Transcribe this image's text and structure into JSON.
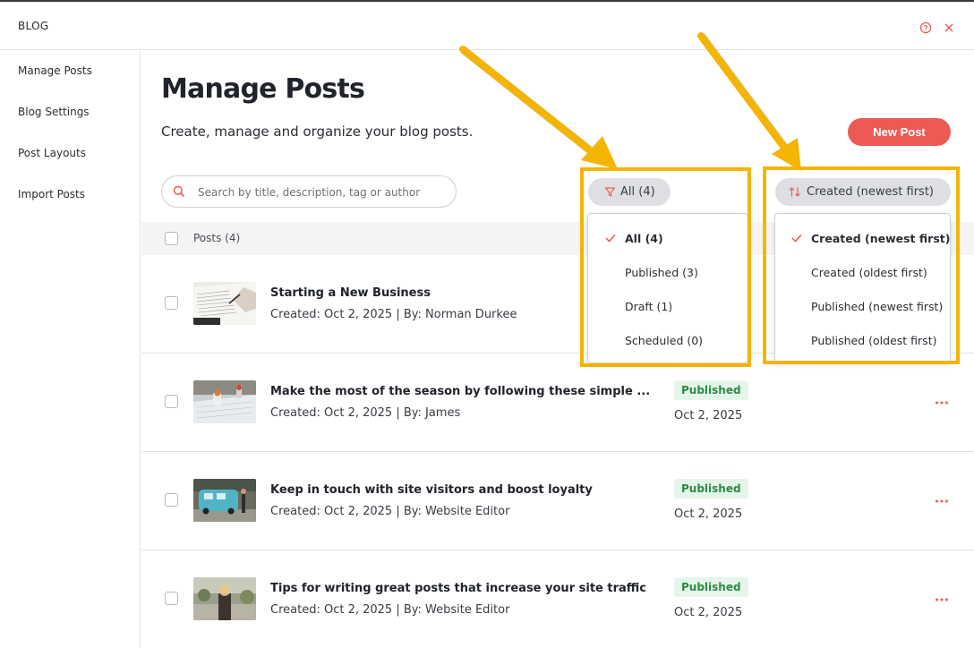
{
  "app": {
    "title": "BLOG"
  },
  "sidebar": {
    "items": [
      {
        "label": "Manage Posts"
      },
      {
        "label": "Blog Settings"
      },
      {
        "label": "Post Layouts"
      },
      {
        "label": "Import Posts"
      }
    ]
  },
  "main": {
    "title": "Manage Posts",
    "subtitle": "Create, manage and organize your blog posts.",
    "new_post_label": "New Post",
    "search": {
      "placeholder": "Search by title, description, tag or author",
      "value": ""
    },
    "filter": {
      "label": "All (4)",
      "options": [
        {
          "label": "All (4)",
          "selected": true
        },
        {
          "label": "Published (3)",
          "selected": false
        },
        {
          "label": "Draft (1)",
          "selected": false
        },
        {
          "label": "Scheduled (0)",
          "selected": false
        }
      ]
    },
    "sort": {
      "label": "Created (newest first)",
      "options": [
        {
          "label": "Created (newest first)",
          "selected": true
        },
        {
          "label": "Created (oldest first)",
          "selected": false
        },
        {
          "label": "Published (newest first)",
          "selected": false
        },
        {
          "label": "Published (oldest first)",
          "selected": false
        }
      ]
    },
    "posts_header": "Posts (4)",
    "posts": [
      {
        "title": "Starting a New Business",
        "meta": "Created: Oct 2, 2025 | By: Norman Durkee",
        "status": "",
        "date": ""
      },
      {
        "title": "Make the most of the season by following these simple ...",
        "meta": "Created: Oct 2, 2025 | By: James",
        "status": "Published",
        "date": "Oct 2, 2025"
      },
      {
        "title": "Keep in touch with site visitors and boost loyalty",
        "meta": "Created: Oct 2, 2025 | By: Website Editor",
        "status": "Published",
        "date": "Oct 2, 2025"
      },
      {
        "title": "Tips for writing great posts that increase your site traffic",
        "meta": "Created: Oct 2, 2025 | By: Website Editor",
        "status": "Published",
        "date": "Oct 2, 2025"
      }
    ]
  },
  "colors": {
    "accent": "#ed5a55",
    "published_bg": "#e4f6e9",
    "published_text": "#2f8a47",
    "highlight": "#f4b400"
  },
  "icons": [
    "help-icon",
    "close-icon",
    "search-icon",
    "filter-icon",
    "sort-icon",
    "check-icon",
    "more-icon"
  ]
}
